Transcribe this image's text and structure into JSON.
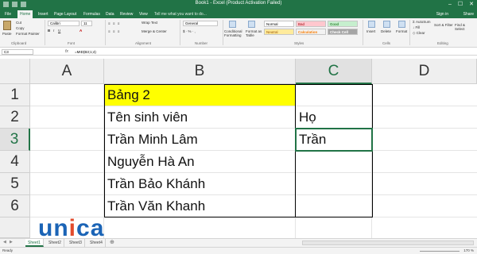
{
  "window": {
    "title": "Book1 - Excel (Product Activation Failed)",
    "controls": [
      "–",
      "☐",
      "✕"
    ]
  },
  "ribbon_tabs": [
    "File",
    "Home",
    "Insert",
    "Page Layout",
    "Formulas",
    "Data",
    "Review",
    "View"
  ],
  "active_tab": "Home",
  "tell_me": "Tell me what you want to do...",
  "sign_in": "Sign in",
  "share": "Share",
  "ribbon": {
    "clipboard": {
      "paste": "Paste",
      "cut": "Cut",
      "copy": "Copy",
      "format_painter": "Format Painter",
      "label": "Clipboard"
    },
    "font": {
      "name": "Calibri",
      "size": "11",
      "label": "Font"
    },
    "alignment": {
      "wrap_text": "Wrap Text",
      "merge_center": "Merge & Center",
      "label": "Alignment"
    },
    "number": {
      "format": "General",
      "label": "Number"
    },
    "styles": {
      "conditional_formatting": "Conditional Formatting",
      "format_as_table": "Format as Table",
      "normal": "Normal",
      "bad": "Bad",
      "good": "Good",
      "neutral": "Neutral",
      "calculation": "Calculation",
      "check_cell": "Check Cell",
      "label": "Styles"
    },
    "cells": {
      "insert": "Insert",
      "delete": "Delete",
      "format": "Format",
      "label": "Cells"
    },
    "editing": {
      "autosum": "AutoSum",
      "fill": "Fill",
      "clear": "Clear",
      "sort_filter": "Sort & Filter",
      "find_select": "Find & Select",
      "label": "Editing"
    }
  },
  "formula_bar": {
    "name_box": "C3",
    "fx": "fx",
    "formula": "=MID(B3;1;4)"
  },
  "columns": [
    "A",
    "B",
    "C",
    "D"
  ],
  "rows": [
    "1",
    "2",
    "3",
    "4",
    "5",
    "6"
  ],
  "cells": {
    "B1": "Bảng 2",
    "B2": "Tên sinh viên",
    "B3": "Trần Minh Lâm",
    "B4": "Nguyễn Hà An",
    "B5": "Trần Bảo Khánh",
    "B6": "Trần Văn Khanh",
    "C2": "Họ",
    "C3": "Trần"
  },
  "colors": {
    "excel_green": "#217346",
    "highlight_yellow": "#ffff00",
    "logo_blue": "#1b64b6",
    "logo_red": "#e24b2c"
  },
  "logo": {
    "u": "u",
    "n": "n",
    "i": "i",
    "c": "c",
    "a": "a"
  },
  "sheets": [
    "Sheet1",
    "Sheet2",
    "Sheet3",
    "Sheet4"
  ],
  "active_sheet": "Sheet1",
  "status": "Ready",
  "zoom": "170 %"
}
